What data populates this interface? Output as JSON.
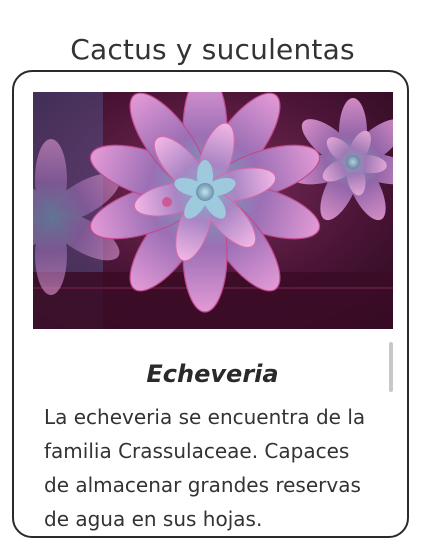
{
  "page": {
    "title": "Cactus y suculentas"
  },
  "card": {
    "image_alt": "Echeveria",
    "heading": "Echeveria",
    "description": "La echeveria se encuentra de la familia Crassulaceae. Capaces de almacenar grandes reservas de agua en sus hojas."
  },
  "colors": {
    "text": "#333333",
    "border": "#2a2a2a",
    "scrollbar": "#c8c8c8"
  }
}
